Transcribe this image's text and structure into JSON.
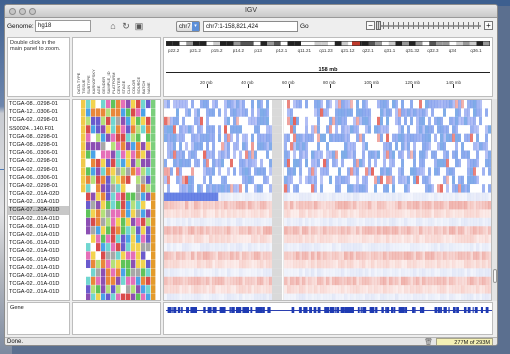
{
  "window": {
    "title": "IGV"
  },
  "toolbar": {
    "genome_label": "Genome:",
    "genome_value": "hg18",
    "chromosome": "chr7",
    "locus": "chr7:1-158,821,424",
    "go_label": "Go",
    "zoom_out": "−",
    "zoom_in": "+"
  },
  "header": {
    "hint": "Double click in the main panel to zoom.",
    "region_length": "158 mb",
    "attribute_columns": [
      "DATA TYPE",
      "TISSUE",
      "SUBTYPE",
      "KARNOFSKY",
      "AGE",
      "GENDER",
      "SAMPLE_ID",
      "PLATFORM",
      "CENTER",
      "STAGE",
      "CLIN",
      "COLOR",
      "SOURCE",
      "BATCH",
      "NAME"
    ],
    "bands": [
      "p22.2",
      "p21.2",
      "p15.2",
      "p14.2",
      "p13",
      "p12.1",
      "q11.21",
      "q11.23",
      "q21.12",
      "q22.1",
      "q31.1",
      "q31.32",
      "q32.3",
      "q34",
      "q36.1"
    ],
    "ruler": [
      "20 mb",
      "40 mb",
      "60 mb",
      "80 mb",
      "100 mb",
      "120 mb",
      "140 mb"
    ]
  },
  "samples": [
    "TCGA-08...0298-01",
    "TCGA-12...0306-01",
    "TCGA-02...0298-01",
    "SS0024...140.F01",
    "TCGA-08...0298-01",
    "TCGA-08...0298-01",
    "TCGA-06...0306-01",
    "TCGA-02...0298-01",
    "TCGA-02...0298-01",
    "TCGA-06...0306-01",
    "TCGA-02...0298-01",
    "TCGA-02...01A-02D",
    "TCGA-02...01A-01D",
    "TCGA-07...20A-01D",
    "TCGA-02...01A-01D",
    "TCGA-08...01A-01D",
    "TCGA-02...01A-01D",
    "TCGA-06...01A-01D",
    "TCGA-02...01A-01D",
    "TCGA-06...01A-05D",
    "TCGA-02...01A-01D",
    "TCGA-02...01A-01D",
    "TCGA-02...01A-01D",
    "TCGA-02...01A-01D"
  ],
  "selected_index": 13,
  "gene_track": {
    "name": "Gene"
  },
  "status": {
    "message": "Done.",
    "memory": "277M of 293M"
  },
  "colors": {
    "deletion": "#3a5fd6",
    "amplification": "#e05a4a",
    "window_bg": "#eeeeee"
  }
}
